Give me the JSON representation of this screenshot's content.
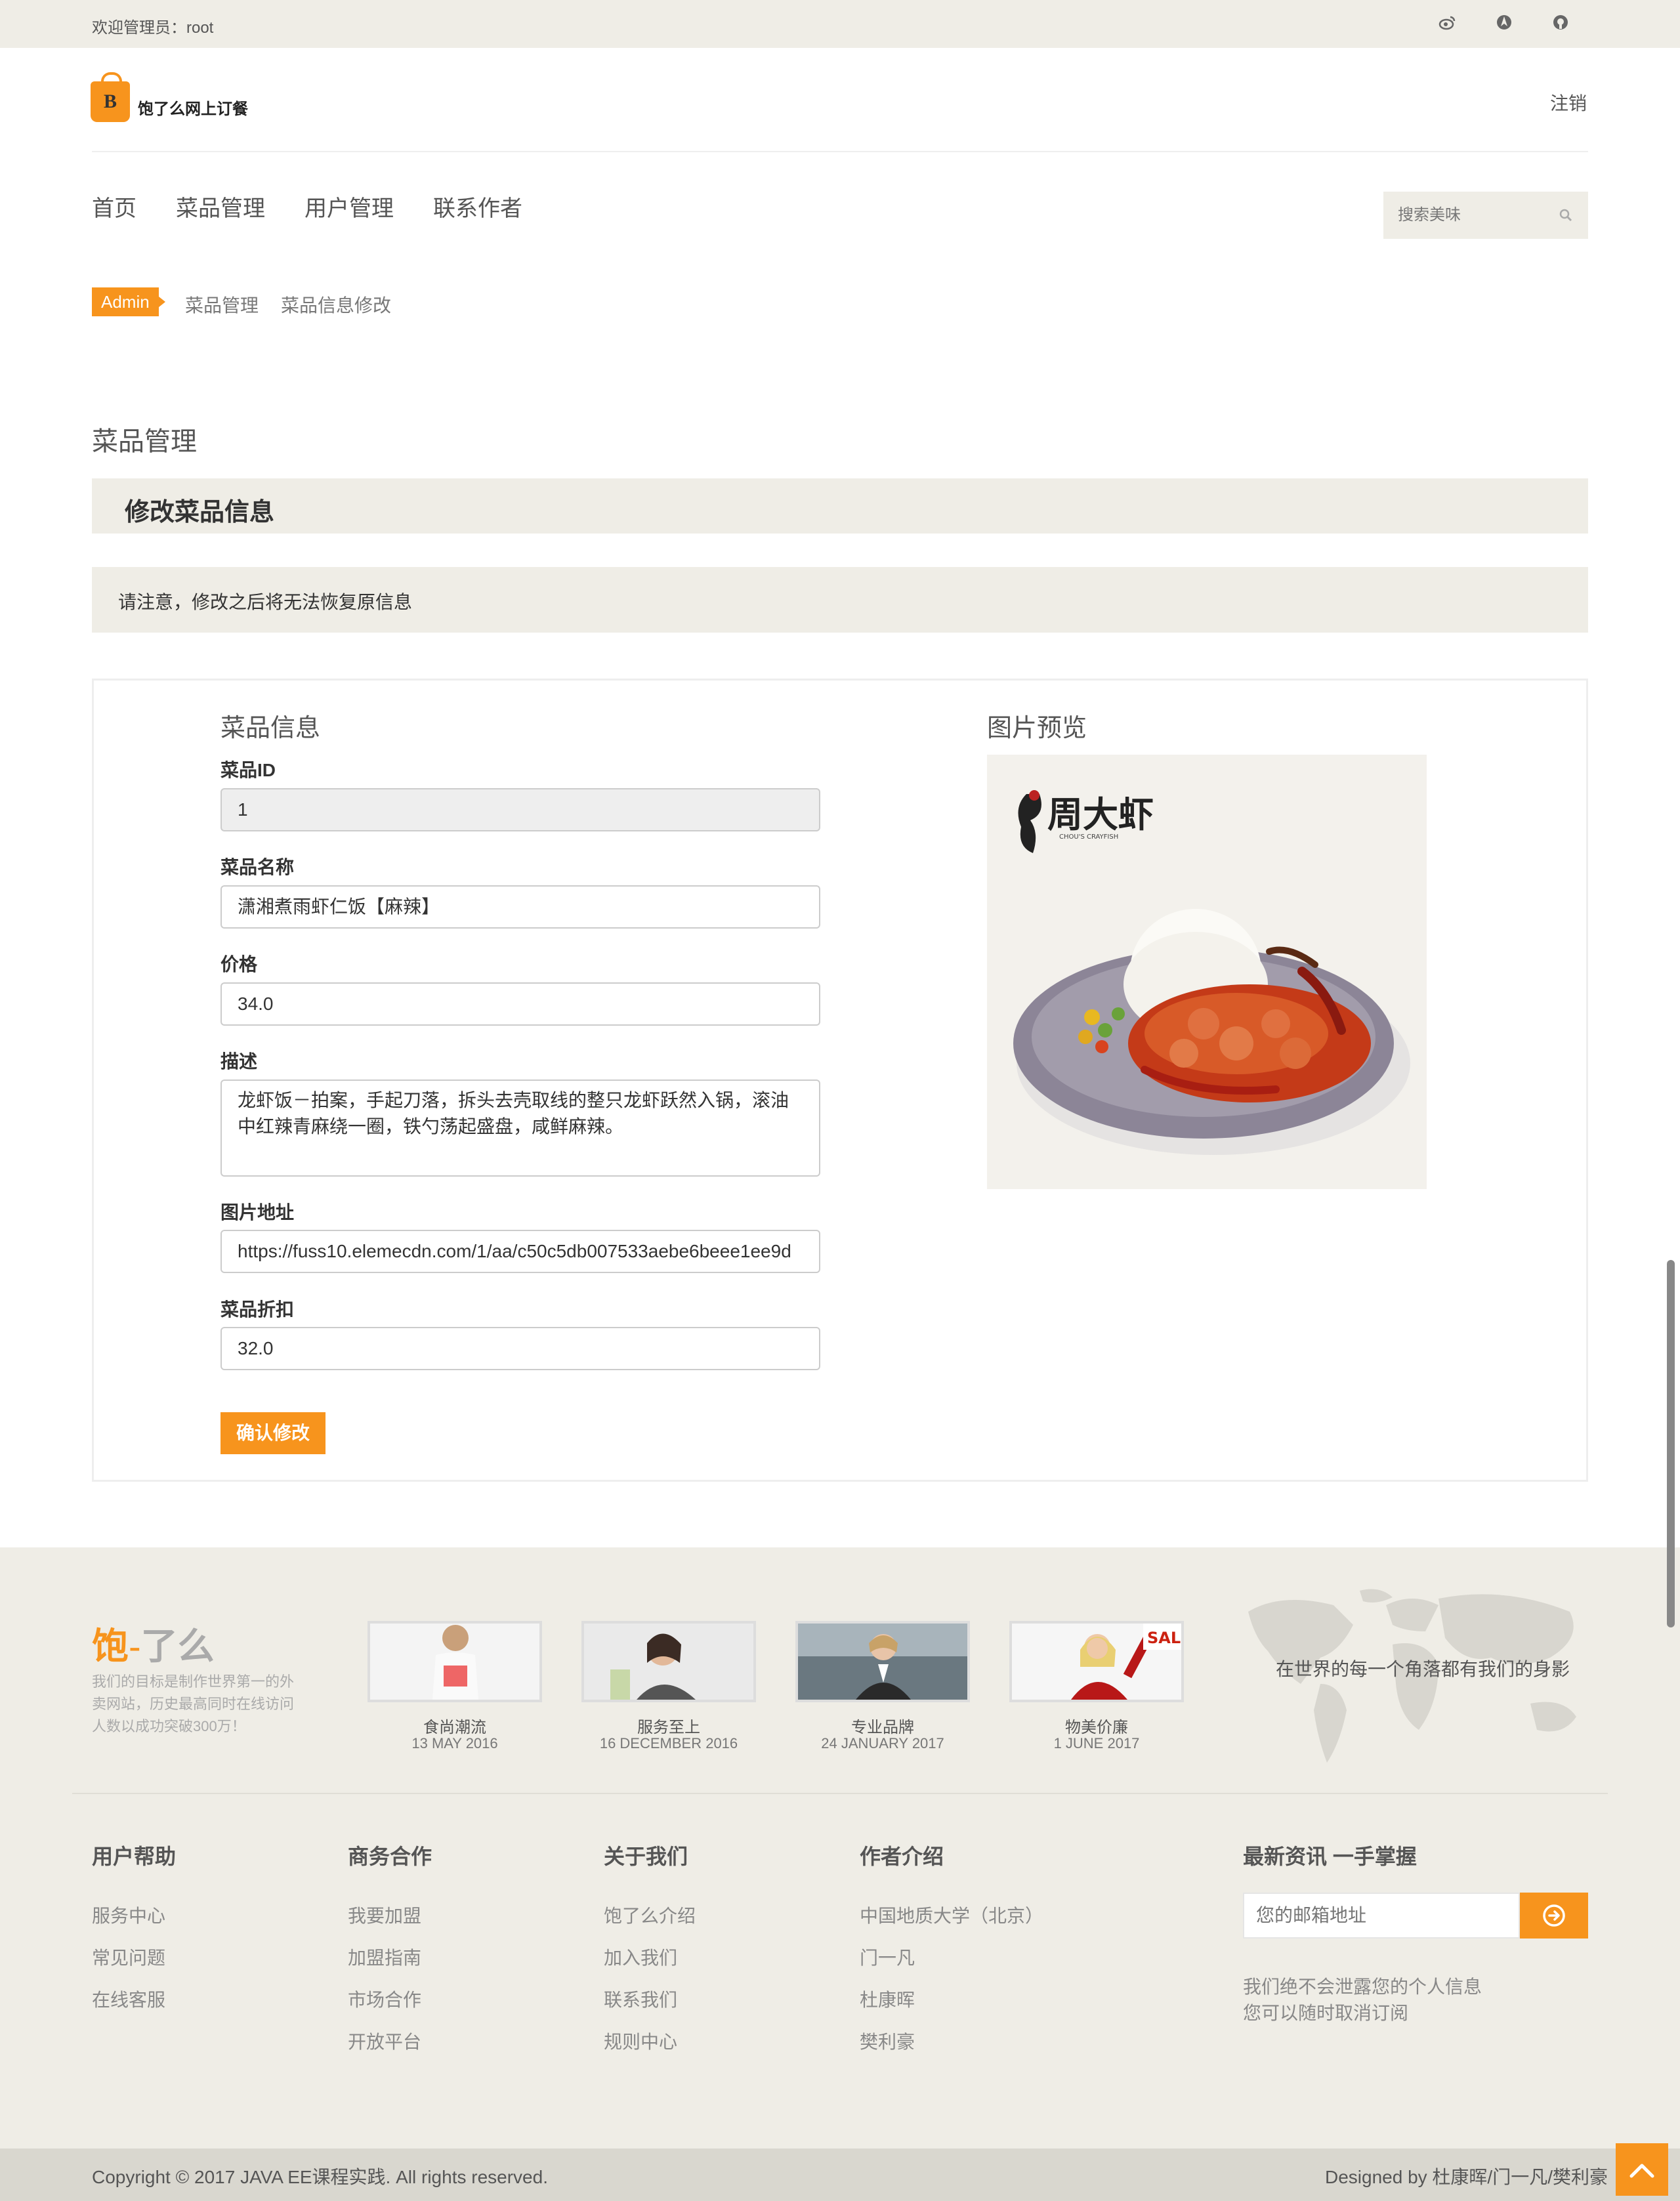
{
  "topbar": {
    "welcome": "欢迎管理员：root",
    "icons": [
      "weibo-icon",
      "tencent-icon",
      "github-icon"
    ]
  },
  "header": {
    "logo_letter": "B",
    "logo_text": "饱了么网上订餐",
    "logout": "注销"
  },
  "nav": {
    "items": [
      "首页",
      "菜品管理",
      "用户管理",
      "联系作者"
    ]
  },
  "search": {
    "placeholder": "搜索美味"
  },
  "breadcrumb": {
    "admin": "Admin",
    "items": [
      "菜品管理",
      "菜品信息修改"
    ]
  },
  "page": {
    "section_title": "菜品管理",
    "box_title": "修改菜品信息",
    "notice": "请注意，修改之后将无法恢复原信息"
  },
  "form": {
    "title": "菜品信息",
    "id_label": "菜品ID",
    "id_value": "1",
    "name_label": "菜品名称",
    "name_value": "潇湘煮雨虾仁饭【麻辣】",
    "price_label": "价格",
    "price_value": "34.0",
    "desc_label": "描述",
    "desc_value": "龙虾饭－拍案，手起刀落，拆头去壳取线的整只龙虾跃然入锅，滚油中红辣青麻绕一圈，铁勺荡起盛盘，咸鲜麻辣。",
    "img_label": "图片地址",
    "img_value": "https://fuss10.elemecdn.com/1/aa/c50c5db007533aebe6beee1ee9d",
    "discount_label": "菜品折扣",
    "discount_value": "32.0",
    "submit": "确认修改"
  },
  "preview": {
    "title": "图片预览",
    "brand_text": "周大虾",
    "brand_sub": "CHOU'S CRAYFISH"
  },
  "footer": {
    "brand_a": "饱",
    "brand_dash": "-",
    "brand_b": "了么",
    "desc": "我们的目标是制作世界第一的外卖网站，历史最高同时在线访问人数以成功突破300万！",
    "gallery": [
      {
        "title": "食尚潮流",
        "date": "13 MAY 2016"
      },
      {
        "title": "服务至上",
        "date": "16 DECEMBER 2016"
      },
      {
        "title": "专业品牌",
        "date": "24 JANUARY 2017"
      },
      {
        "title": "物美价廉",
        "date": "1 JUNE 2017"
      }
    ],
    "sale_text": "SAL",
    "map_slogan": "在世界的每一个角落都有我们的身影",
    "columns": [
      {
        "title": "用户帮助",
        "links": [
          "服务中心",
          "常见问题",
          "在线客服"
        ]
      },
      {
        "title": "商务合作",
        "links": [
          "我要加盟",
          "加盟指南",
          "市场合作",
          "开放平台"
        ]
      },
      {
        "title": "关于我们",
        "links": [
          "饱了么介绍",
          "加入我们",
          "联系我们",
          "规则中心"
        ]
      },
      {
        "title": "作者介绍",
        "links": [
          "中国地质大学（北京）",
          "门一凡",
          "杜康晖",
          "樊利豪"
        ]
      }
    ],
    "news_title": "最新资讯 一手掌握",
    "email_placeholder": "您的邮箱地址",
    "privacy_1": "我们绝不会泄露您的个人信息",
    "privacy_2": "您可以随时取消订阅",
    "copyright": "Copyright © 2017 JAVA EE课程实践. All rights reserved.",
    "designed": "Designed by 杜康晖/门一凡/樊利豪"
  },
  "colors": {
    "accent": "#f7941d",
    "panel_bg": "#efede6"
  }
}
